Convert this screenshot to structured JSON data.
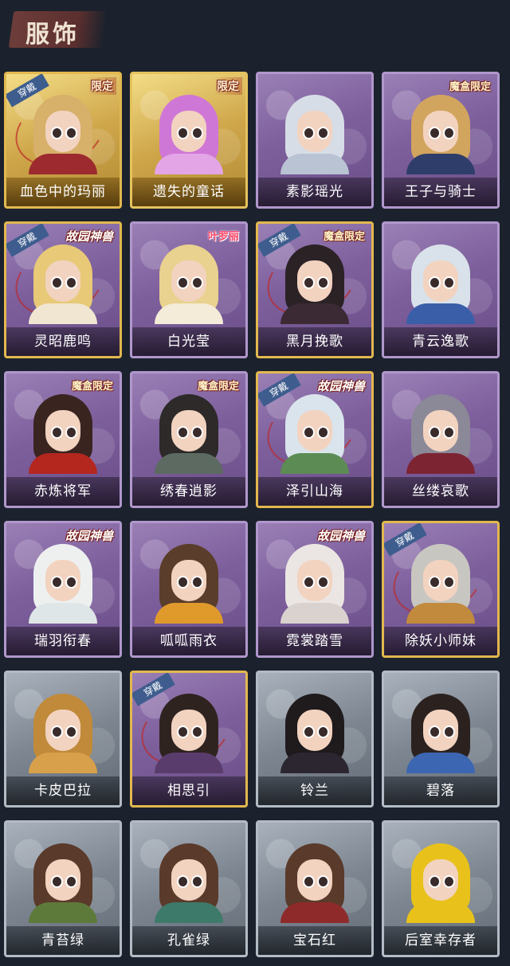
{
  "header": {
    "title": "服饰"
  },
  "badges": {
    "equipped": "穿戴"
  },
  "cards": [
    {
      "name": "血色中的玛丽",
      "style": "gold",
      "tag": "限定",
      "equipped": true,
      "hair": "#d7b06a",
      "body": "#9c2a2e"
    },
    {
      "name": "遗失的童话",
      "style": "gold",
      "tag": "限定",
      "equipped": false,
      "hair": "#cf77d6",
      "body": "#e3a5e6"
    },
    {
      "name": "素影瑶光",
      "style": "purple",
      "tag": "",
      "equipped": false,
      "hair": "#d7dde6",
      "body": "#b9c3d3"
    },
    {
      "name": "王子与骑士",
      "style": "purple",
      "tag": "魔盒限定",
      "equipped": false,
      "hair": "#d2a55f",
      "body": "#2f3d6a"
    },
    {
      "name": "灵昭鹿鸣",
      "style": "purple",
      "tag": "故园神兽",
      "equipped": true,
      "hair": "#e7c978",
      "body": "#f1e6d2"
    },
    {
      "name": "白光莹",
      "style": "purple",
      "tag": "叶罗丽",
      "equipped": false,
      "hair": "#e9d18f",
      "body": "#f4ecd8"
    },
    {
      "name": "黑月挽歌",
      "style": "purple",
      "tag": "魔盒限定",
      "equipped": true,
      "hair": "#2b2226",
      "body": "#3b2a34"
    },
    {
      "name": "青云逸歌",
      "style": "purple",
      "tag": "",
      "equipped": false,
      "hair": "#d9e2ea",
      "body": "#3a5ea8"
    },
    {
      "name": "赤炼将军",
      "style": "purple",
      "tag": "魔盒限定",
      "equipped": false,
      "hair": "#3a2420",
      "body": "#b3271f"
    },
    {
      "name": "绣春逍影",
      "style": "purple",
      "tag": "魔盒限定",
      "equipped": false,
      "hair": "#2d2a29",
      "body": "#5d6a62"
    },
    {
      "name": "泽引山海",
      "style": "purple",
      "tag": "故园神兽",
      "equipped": true,
      "hair": "#d9e4ec",
      "body": "#5c8c54"
    },
    {
      "name": "丝缕哀歌",
      "style": "purple",
      "tag": "",
      "equipped": false,
      "hair": "#8b8897",
      "body": "#7d2433"
    },
    {
      "name": "瑞羽衔春",
      "style": "purple",
      "tag": "故园神兽",
      "equipped": false,
      "hair": "#eef0f0",
      "body": "#dfe6e8"
    },
    {
      "name": "呱呱雨衣",
      "style": "purple",
      "tag": "",
      "equipped": false,
      "hair": "#5a3d2a",
      "body": "#e09a2c"
    },
    {
      "name": "霓裳踏雪",
      "style": "purple",
      "tag": "故园神兽",
      "equipped": false,
      "hair": "#ebe6e4",
      "body": "#d9d2ce"
    },
    {
      "name": "除妖小师妹",
      "style": "purple",
      "tag": "",
      "equipped": true,
      "hair": "#c8c6c0",
      "body": "#c28a3d"
    },
    {
      "name": "卡皮巴拉",
      "style": "gray",
      "tag": "",
      "equipped": false,
      "hair": "#c08a3a",
      "body": "#d9a04b"
    },
    {
      "name": "相思引",
      "style": "purple",
      "tag": "",
      "equipped": true,
      "hair": "#2f2320",
      "body": "#5a3c6c"
    },
    {
      "name": "铃兰",
      "style": "gray",
      "tag": "",
      "equipped": false,
      "hair": "#1f1a1c",
      "body": "#2b2630"
    },
    {
      "name": "碧落",
      "style": "gray",
      "tag": "",
      "equipped": false,
      "hair": "#2b2220",
      "body": "#3c66b2"
    },
    {
      "name": "青苔绿",
      "style": "gray",
      "tag": "",
      "equipped": false,
      "hair": "#5a3a2a",
      "body": "#5e7a3a"
    },
    {
      "name": "孔雀绿",
      "style": "gray",
      "tag": "",
      "equipped": false,
      "hair": "#5a3a2a",
      "body": "#3e7a6a"
    },
    {
      "name": "宝石红",
      "style": "gray",
      "tag": "",
      "equipped": false,
      "hair": "#5a3a2a",
      "body": "#8e2a2a"
    },
    {
      "name": "后室幸存者",
      "style": "gray",
      "tag": "",
      "equipped": false,
      "hair": "#e8c21a",
      "body": "#e8c21a"
    }
  ]
}
